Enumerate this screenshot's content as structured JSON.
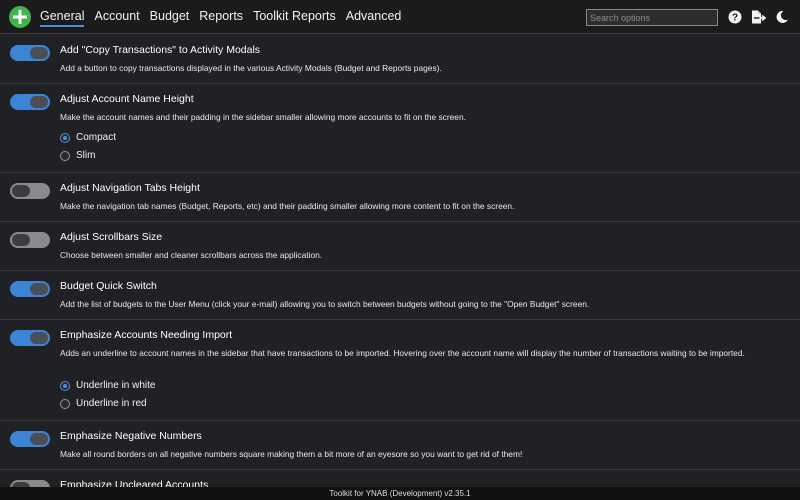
{
  "header": {
    "tabs": [
      "General",
      "Account",
      "Budget",
      "Reports",
      "Toolkit Reports",
      "Advanced"
    ],
    "active_tab": "General",
    "search_placeholder": "Search options",
    "icons": [
      "add-logo-icon",
      "help-icon",
      "export-icon",
      "dark-mode-icon"
    ],
    "accent_color": "#4a90d9",
    "logo_color": "#3fb54a"
  },
  "settings": [
    {
      "title": "Add \"Copy Transactions\" to Activity Modals",
      "description": "Add a button to copy transactions displayed in the various Activity Modals (Budget and Reports pages).",
      "enabled": true
    },
    {
      "title": "Adjust Account Name Height",
      "description": "Make the account names and their padding in the sidebar smaller allowing more accounts to fit on the screen.",
      "enabled": true,
      "options": [
        "Compact",
        "Slim"
      ],
      "selected": "Compact"
    },
    {
      "title": "Adjust Navigation Tabs Height",
      "description": "Make the navigation tab names (Budget, Reports, etc) and their padding smaller allowing more content to fit on the screen.",
      "enabled": false
    },
    {
      "title": "Adjust Scrollbars Size",
      "description": "Choose between smaller and cleaner scrollbars across the application.",
      "enabled": false
    },
    {
      "title": "Budget Quick Switch",
      "description": "Add the list of budgets to the User Menu (click your e-mail) allowing you to switch between budgets without going to the \"Open Budget\" screen.",
      "enabled": true
    },
    {
      "title": "Emphasize Accounts Needing Import",
      "description": "Adds an underline to account names in the sidebar that have transactions to be imported. Hovering over the account name will display the number of transactions waiting to be imported.",
      "enabled": true,
      "options": [
        "Underline in white",
        "Underline in red"
      ],
      "selected": "Underline in white"
    },
    {
      "title": "Emphasize Negative Numbers",
      "description": "Make all round borders on all negative numbers square making them a bit more of an eyesore so you want to get rid of them!",
      "enabled": true
    },
    {
      "title": "Emphasize Uncleared Accounts",
      "description": "",
      "enabled": false
    }
  ],
  "footer": {
    "text": "Toolkit for YNAB (Development) v2.35.1"
  }
}
